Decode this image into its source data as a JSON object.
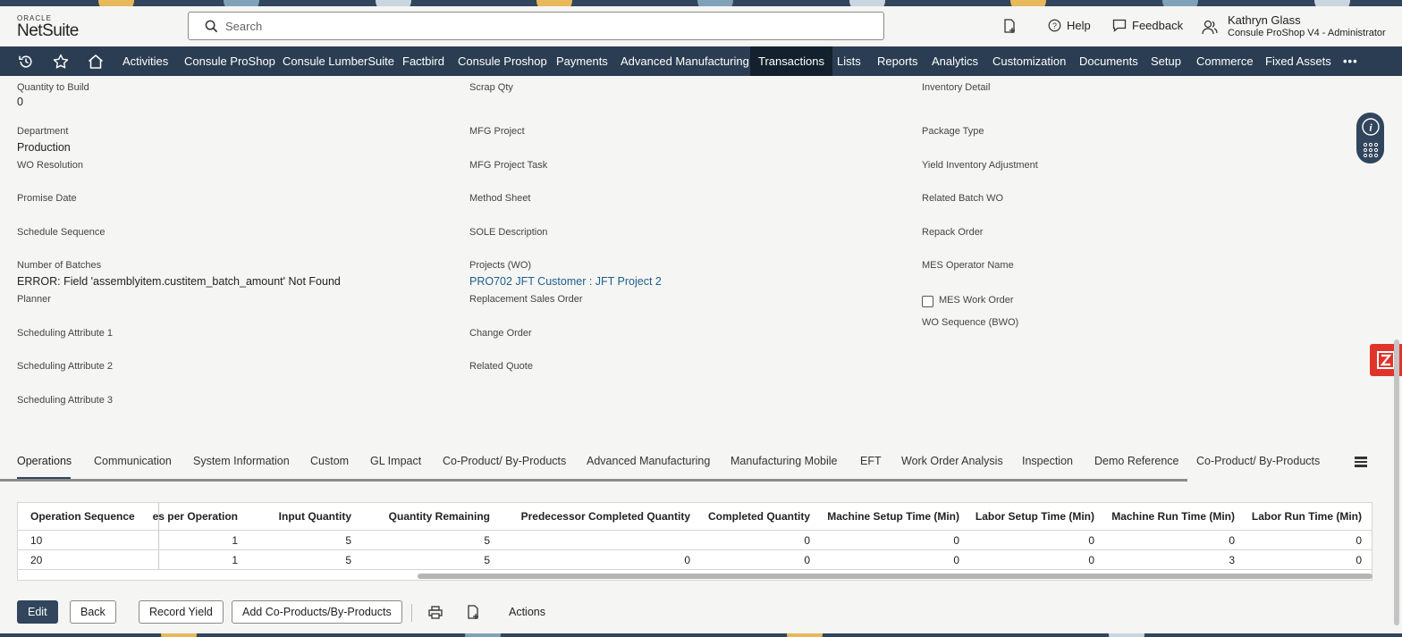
{
  "brand": {
    "oracle": "ORACLE",
    "netsuite": "NetSuite"
  },
  "search": {
    "placeholder": "Search"
  },
  "header": {
    "help": "Help",
    "feedback": "Feedback",
    "user_name": "Kathryn Glass",
    "user_role": "Consule ProShop V4 - Administrator"
  },
  "nav": {
    "items": [
      "Activities",
      "Consule ProShop",
      "Consule LumberSuite",
      "Factbird",
      "Consule Proshop",
      "Payments",
      "Advanced Manufacturing",
      "Transactions",
      "Lists",
      "Reports",
      "Analytics",
      "Customization",
      "Documents",
      "Setup",
      "Commerce",
      "Fixed Assets"
    ],
    "active": "Transactions",
    "more": "•••"
  },
  "fields": {
    "quantity_to_build": {
      "label": "Quantity to Build",
      "value": "0"
    },
    "scrap_qty": {
      "label": "Scrap Qty"
    },
    "inventory_detail": {
      "label": "Inventory Detail"
    },
    "department": {
      "label": "Department",
      "value": "Production"
    },
    "mfg_project": {
      "label": "MFG Project"
    },
    "package_type": {
      "label": "Package Type"
    },
    "wo_resolution": {
      "label": "WO Resolution"
    },
    "mfg_project_task": {
      "label": "MFG Project Task"
    },
    "yield_inventory_adjustment": {
      "label": "Yield Inventory Adjustment"
    },
    "promise_date": {
      "label": "Promise Date"
    },
    "method_sheet": {
      "label": "Method Sheet"
    },
    "related_batch_wo": {
      "label": "Related Batch WO"
    },
    "schedule_sequence": {
      "label": "Schedule Sequence"
    },
    "sole_description": {
      "label": "SOLE Description"
    },
    "repack_order": {
      "label": "Repack Order"
    },
    "number_of_batches": {
      "label": "Number of Batches",
      "value": "ERROR: Field 'assemblyitem.custitem_batch_amount' Not Found"
    },
    "projects_wo": {
      "label": "Projects (WO)",
      "value": "PRO702 JFT Customer : JFT Project 2"
    },
    "mes_operator_name": {
      "label": "MES Operator Name"
    },
    "planner": {
      "label": "Planner"
    },
    "replacement_sales_order": {
      "label": "Replacement Sales Order"
    },
    "mes_work_order": {
      "label": "MES Work Order",
      "checked": false
    },
    "wo_sequence_bwo": {
      "label": "WO Sequence (BWO)"
    },
    "scheduling_attribute_1": {
      "label": "Scheduling Attribute 1"
    },
    "change_order": {
      "label": "Change Order"
    },
    "scheduling_attribute_2": {
      "label": "Scheduling Attribute 2"
    },
    "related_quote": {
      "label": "Related Quote"
    },
    "scheduling_attribute_3": {
      "label": "Scheduling Attribute 3"
    }
  },
  "tabs": [
    "Operations",
    "Communication",
    "System Information",
    "Custom",
    "GL Impact",
    "Co-Product/ By-Products",
    "Advanced Manufacturing",
    "Manufacturing Mobile",
    "EFT",
    "Work Order Analysis",
    "Inspection",
    "Demo Reference",
    "Co-Product/ By-Products"
  ],
  "active_tab": "Operations",
  "grid": {
    "columns": [
      "Operation Sequence",
      "es per Operation",
      "Input Quantity",
      "Quantity Remaining",
      "Predecessor Completed Quantity",
      "Completed Quantity",
      "Machine Setup Time (Min)",
      "Labor Setup Time (Min)",
      "Machine Run Time (Min)",
      "Labor Run Time (Min)"
    ],
    "rows": [
      [
        "10",
        "1",
        "5",
        "5",
        "",
        "0",
        "0",
        "0",
        "0",
        "0"
      ],
      [
        "20",
        "1",
        "5",
        "5",
        "0",
        "0",
        "0",
        "0",
        "3",
        "0"
      ]
    ]
  },
  "buttons": {
    "edit": "Edit",
    "back": "Back",
    "record_yield": "Record Yield",
    "add_coproducts": "Add Co-Products/By-Products",
    "actions": "Actions"
  },
  "colors": {
    "nav_bg": "#2b3d52",
    "nav_active": "#13202d",
    "primary": "#31455c",
    "link": "#1f5f8b",
    "zone_red": "#e0342b"
  }
}
